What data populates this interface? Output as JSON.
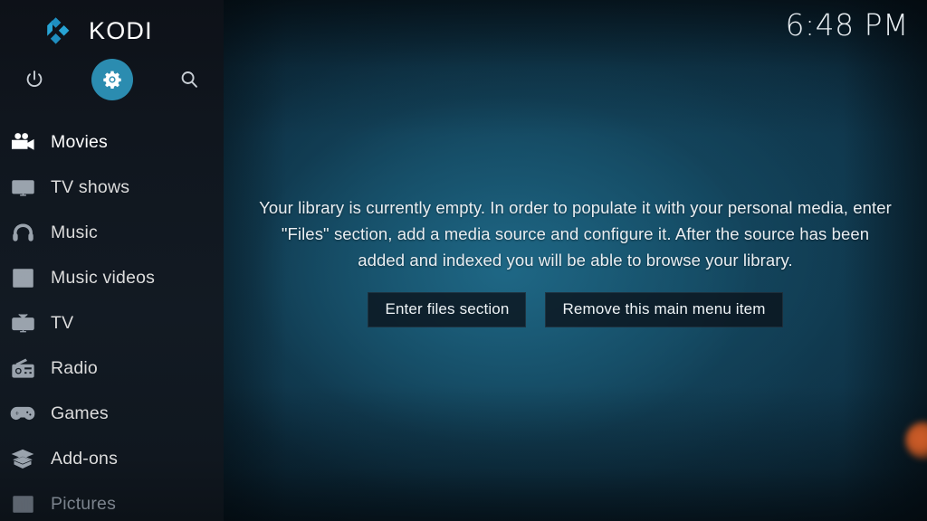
{
  "app": {
    "name": "KODI",
    "logo_icon": "kodi-diamond-logo",
    "accent_color": "#2b8cb0",
    "sidebar_bg": "#121a23"
  },
  "clock": {
    "time": "6:48 PM"
  },
  "top_icons": [
    {
      "name": "power-icon",
      "label": "Power"
    },
    {
      "name": "gear-icon",
      "label": "Settings",
      "selected": true
    },
    {
      "name": "search-icon",
      "label": "Search"
    }
  ],
  "sidebar": {
    "items": [
      {
        "label": "Movies",
        "icon": "movie-camera-icon",
        "state": "active"
      },
      {
        "label": "TV shows",
        "icon": "monitor-icon",
        "state": "dim"
      },
      {
        "label": "Music",
        "icon": "headphones-icon",
        "state": "dim"
      },
      {
        "label": "Music videos",
        "icon": "film-note-icon",
        "state": "dim"
      },
      {
        "label": "TV",
        "icon": "television-icon",
        "state": "dim"
      },
      {
        "label": "Radio",
        "icon": "radio-icon",
        "state": "dim"
      },
      {
        "label": "Games",
        "icon": "gamepad-icon",
        "state": "dim"
      },
      {
        "label": "Add-ons",
        "icon": "addon-box-icon",
        "state": "dim"
      },
      {
        "label": "Pictures",
        "icon": "pictures-icon",
        "state": "faded"
      }
    ]
  },
  "main": {
    "empty_message": "Your library is currently empty. In order to populate it with your personal media, enter \"Files\" section, add a media source and configure it. After the source has been added and indexed you will be able to browse your library.",
    "buttons": {
      "enter_files": "Enter files section",
      "remove_item": "Remove this main menu item"
    }
  }
}
